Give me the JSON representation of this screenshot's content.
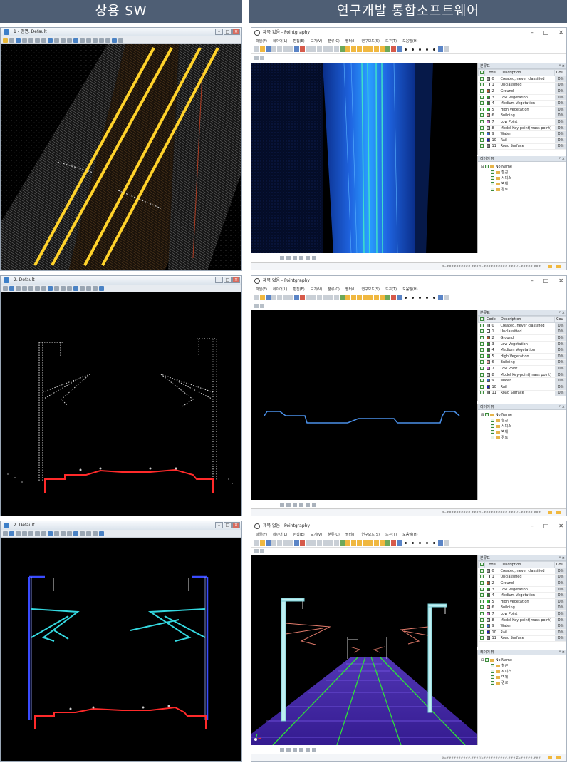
{
  "headers": {
    "left": "상용 SW",
    "right": "연구개발 통합소프트웨어"
  },
  "left_windows": [
    {
      "title": "1 - 평면. Default"
    },
    {
      "title": "2. Default"
    },
    {
      "title": "2. Default"
    }
  ],
  "right_window": {
    "title": "제목 없음 - Pointgraphy",
    "menu": [
      "파일(F)",
      "레이어(L)",
      "편집(E)",
      "보기(V)",
      "분류(C)",
      "필터(I)",
      "연구모드(S)",
      "도구(T)",
      "도움말(H)"
    ],
    "window_controls": [
      "–",
      "□",
      "✕"
    ]
  },
  "class_panel": {
    "title": "분류표",
    "pin": "ᵖ ×",
    "headers": [
      "Code",
      "Description",
      "Cou"
    ],
    "rows": [
      {
        "code": "0",
        "desc": "Created, never classified",
        "pct": "0%",
        "color": "#9a9a9a"
      },
      {
        "code": "1",
        "desc": "Unclassified",
        "pct": "0%",
        "color": "#ffffff"
      },
      {
        "code": "2",
        "desc": "Ground",
        "pct": "0%",
        "color": "#b45a28"
      },
      {
        "code": "3",
        "desc": "Low Vegetation",
        "pct": "0%",
        "color": "#2e9b2e"
      },
      {
        "code": "4",
        "desc": "Medium Vegetation",
        "pct": "0%",
        "color": "#2a7f2a"
      },
      {
        "code": "5",
        "desc": "High Vegetation",
        "pct": "0%",
        "color": "#35c035"
      },
      {
        "code": "6",
        "desc": "Building",
        "pct": "0%",
        "color": "#e8a0a0"
      },
      {
        "code": "7",
        "desc": "Low Point",
        "pct": "0%",
        "color": "#d878d8"
      },
      {
        "code": "8",
        "desc": "Model Key-point(mass point)",
        "pct": "0%",
        "color": "#c8c8c8"
      },
      {
        "code": "9",
        "desc": "Water",
        "pct": "0%",
        "color": "#3a6fd8"
      },
      {
        "code": "10",
        "desc": "Rail",
        "pct": "0%",
        "color": "#2020c0"
      },
      {
        "code": "11",
        "desc": "Road Surface",
        "pct": "0%",
        "color": "#7f7f7f"
      }
    ]
  },
  "layer_panel": {
    "title": "레이어 뷰",
    "root": "No Name",
    "items": [
      "철근",
      "서피스",
      "벽체",
      "경로"
    ]
  },
  "status": {
    "coords": "X=##########.### Y=##########.### Z=#####.###"
  },
  "colors": {
    "header_bg": "#4e5e74",
    "rail_red": "#ff2a2a",
    "pole_blue": "#3a4cff",
    "wire_cyan": "#34d8e0",
    "rail_green": "#2fe03a",
    "ground_blue": "#4a90e8",
    "yellow": "#ffd22a"
  }
}
